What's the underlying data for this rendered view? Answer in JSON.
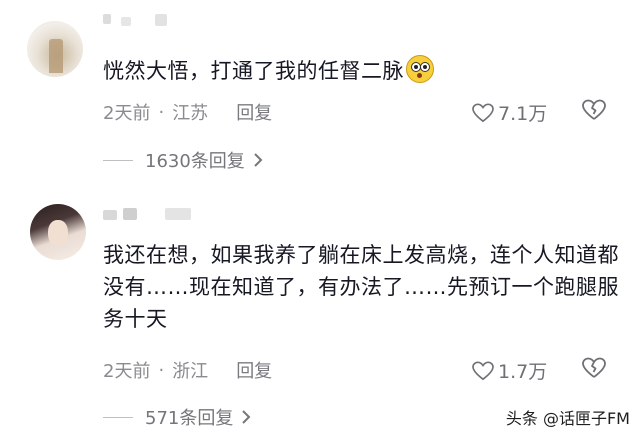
{
  "comments": [
    {
      "text": "恍然大悟，打通了我的任督二脉",
      "emoji": "shocked-face-emoji",
      "time": "2天前",
      "separator": "·",
      "location": "江苏",
      "reply_label": "回复",
      "likes": "7.1万",
      "replies_label": "1630条回复"
    },
    {
      "text": "我还在想，如果我养了躺在床上发高烧，连个人知道都没有……现在知道了，有办法了……先预订一个跑腿服务十天",
      "time": "2天前",
      "separator": "·",
      "location": "浙江",
      "reply_label": "回复",
      "likes": "1.7万",
      "replies_label": "571条回复"
    }
  ],
  "watermark": "头条 @话匣子FM",
  "colors": {
    "text": "#161823",
    "meta": "#8a8b91",
    "emoji": "#f7cf3b"
  }
}
